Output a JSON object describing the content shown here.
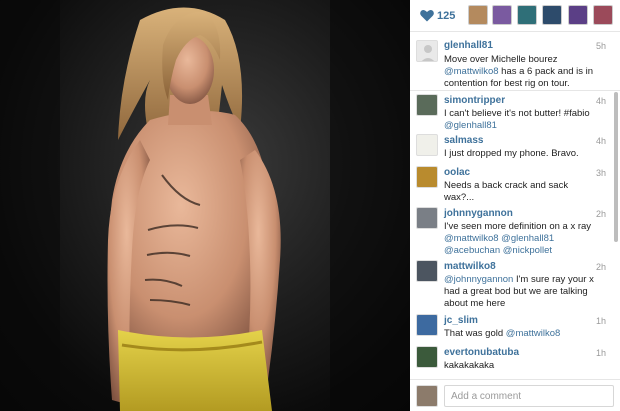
{
  "likes": {
    "count": "125"
  },
  "likers": [
    {
      "name": "liker-1",
      "color": "#b48a5e"
    },
    {
      "name": "liker-2",
      "color": "#7a5aa0"
    },
    {
      "name": "liker-3",
      "color": "#2f6f78"
    },
    {
      "name": "liker-4",
      "color": "#2d4b6b"
    },
    {
      "name": "liker-5",
      "color": "#5b3f86"
    },
    {
      "name": "liker-6",
      "color": "#9b4a5a"
    }
  ],
  "caption": {
    "user": "glenhall81",
    "time": "5h",
    "text": "Move over Michelle bourez",
    "mention": "@mattwilko8",
    "text2": " has a 6 pack and is in contention for best rig on tour."
  },
  "comments": [
    {
      "user": "simontripper",
      "time": "4h",
      "t1": "I can't believe it's not butter! #fabio",
      "m1": "@glenhall81"
    },
    {
      "user": "salmass",
      "time": "4h",
      "t1": "I just dropped my phone. Bravo."
    },
    {
      "user": "oolac",
      "time": "3h",
      "t1": "Needs a back crack and sack",
      "t2": "wax?..."
    },
    {
      "user": "johnnygannon",
      "time": "2h",
      "t1": "I've seen more definition on a x ray",
      "m1": "@mattwilko8",
      "m2": "@glenhall81",
      "m3": "@acebuchan",
      "m4": "@nickpollet"
    },
    {
      "user": "mattwilko8",
      "time": "2h",
      "m1": "@johnnygannon",
      "t1": " I'm sure ray your x had a great bod but we are talking about me here"
    },
    {
      "user": "jc_slim",
      "time": "1h",
      "t1": "That was gold ",
      "m1": "@mattwilko8"
    },
    {
      "user": "evertonubatuba",
      "time": "1h",
      "t1": "kakakakaka"
    }
  ],
  "comment_box": {
    "placeholder": "Add a comment"
  },
  "colors": {
    "link": "#3f729b",
    "heart": "#3f729b",
    "shorts": "#d6c23a"
  }
}
